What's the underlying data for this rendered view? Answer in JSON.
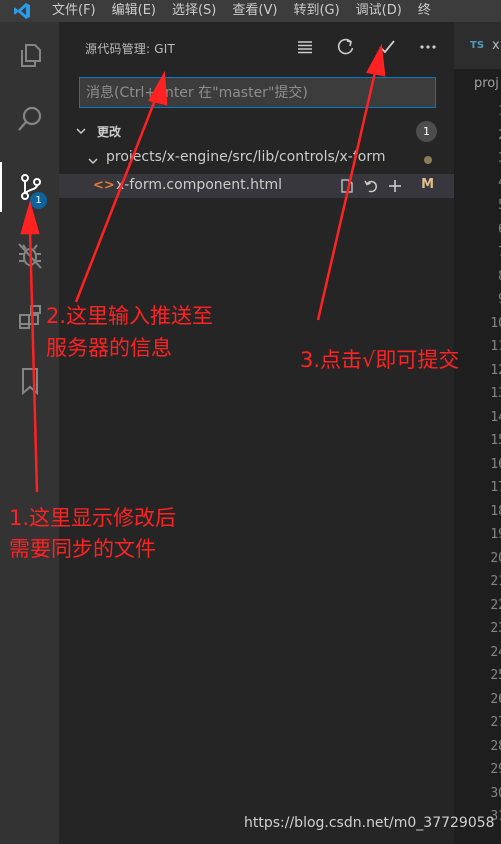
{
  "menubar": {
    "items": [
      "文件(F)",
      "编辑(E)",
      "选择(S)",
      "查看(V)",
      "转到(G)",
      "调试(D)",
      "终"
    ]
  },
  "activity_bar": {
    "scm_badge": "1"
  },
  "sidebar": {
    "header": "源代码管理: GIT",
    "commit_placeholder": "消息(Ctrl+Enter 在\"master\"提交)",
    "group": {
      "label": "更改",
      "count": "1"
    },
    "folder": {
      "path": "projects/x-engine/src/lib/controls/x-form"
    },
    "file": {
      "name": "x-form.component.html",
      "status": "M"
    }
  },
  "editor": {
    "tab_lang": "TS",
    "tab_name": "x",
    "breadcrumb": "proj",
    "line_numbers": [
      "1",
      "2",
      "3",
      "4",
      "5",
      "6",
      "7",
      "8",
      "9",
      "10",
      "11",
      "12",
      "13",
      "14",
      "15",
      "16",
      "17",
      "18",
      "19",
      "20",
      "21",
      "22",
      "23",
      "24",
      "25",
      "26",
      "27",
      "28",
      "29",
      "30",
      "31"
    ]
  },
  "annotations": {
    "a1_line1": "1.这里显示修改后",
    "a1_line2": "需要同步的文件",
    "a2_line1": "2.这里输入推送至",
    "a2_line2": "服务器的信息",
    "a3": "3.点击√即可提交"
  },
  "watermark": "https://blog.csdn.net/m0_37729058",
  "colors": {
    "accent": "#007acc",
    "annotation": "#ff2222",
    "modified": "#e2c08d"
  }
}
